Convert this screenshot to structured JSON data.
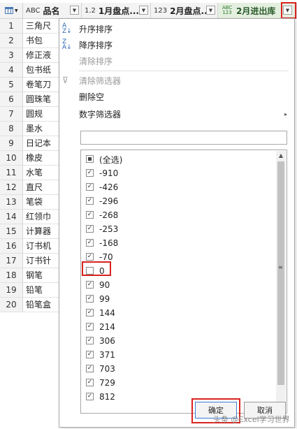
{
  "header": {
    "columns": [
      {
        "type": "ABC",
        "label": "品名"
      },
      {
        "type": "1.2",
        "label": "1月盘点..."
      },
      {
        "type": "123",
        "label": "2月盘点..."
      },
      {
        "type": "ABC 123",
        "label": "2月进出库"
      }
    ]
  },
  "rows": [
    {
      "n": "1",
      "name": "三角尺"
    },
    {
      "n": "2",
      "name": "书包"
    },
    {
      "n": "3",
      "name": "修正液"
    },
    {
      "n": "4",
      "name": "包书纸"
    },
    {
      "n": "5",
      "name": "卷笔刀"
    },
    {
      "n": "6",
      "name": "圆珠笔"
    },
    {
      "n": "7",
      "name": "圆规"
    },
    {
      "n": "8",
      "name": "墨水"
    },
    {
      "n": "9",
      "name": "日记本"
    },
    {
      "n": "10",
      "name": "橡皮"
    },
    {
      "n": "11",
      "name": "水笔"
    },
    {
      "n": "12",
      "name": "直尺"
    },
    {
      "n": "13",
      "name": "笔袋"
    },
    {
      "n": "14",
      "name": "红领巾"
    },
    {
      "n": "15",
      "name": "计算器"
    },
    {
      "n": "16",
      "name": "订书机"
    },
    {
      "n": "17",
      "name": "订书针"
    },
    {
      "n": "18",
      "name": "钢笔"
    },
    {
      "n": "19",
      "name": "铅笔"
    },
    {
      "n": "20",
      "name": "铅笔盒"
    }
  ],
  "menu": {
    "sort_asc": "升序排序",
    "sort_desc": "降序排序",
    "clear_sort": "清除排序",
    "clear_filter": "清除筛选器",
    "remove_empty": "删除空",
    "number_filters": "数字筛选器"
  },
  "search": {
    "value": ""
  },
  "filter_list": [
    {
      "label": "(全选)",
      "state": "partial"
    },
    {
      "label": "-910",
      "state": "checked"
    },
    {
      "label": "-426",
      "state": "checked"
    },
    {
      "label": "-296",
      "state": "checked"
    },
    {
      "label": "-268",
      "state": "checked"
    },
    {
      "label": "-253",
      "state": "checked"
    },
    {
      "label": "-168",
      "state": "checked"
    },
    {
      "label": "-70",
      "state": "checked"
    },
    {
      "label": "0",
      "state": "unchecked"
    },
    {
      "label": "90",
      "state": "checked"
    },
    {
      "label": "99",
      "state": "checked"
    },
    {
      "label": "144",
      "state": "checked"
    },
    {
      "label": "214",
      "state": "checked"
    },
    {
      "label": "306",
      "state": "checked"
    },
    {
      "label": "371",
      "state": "checked"
    },
    {
      "label": "703",
      "state": "checked"
    },
    {
      "label": "729",
      "state": "checked"
    },
    {
      "label": "812",
      "state": "checked"
    }
  ],
  "buttons": {
    "ok": "确定",
    "cancel": "取消"
  },
  "watermark": "头条 @Excel学习世界",
  "colors": {
    "highlight": "#d9231f"
  }
}
